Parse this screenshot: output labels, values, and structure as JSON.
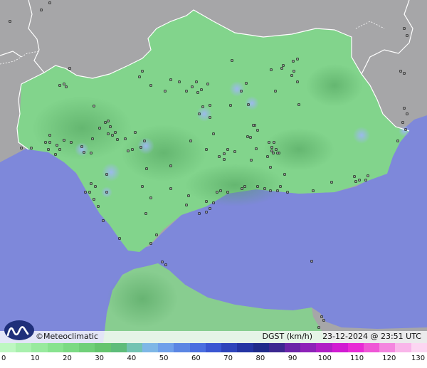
{
  "map": {
    "brand": "©Meteoclimatic",
    "caption_variable": "DGST (km/h)",
    "caption_datetime": "23-12-2024 @ 23:51 UTC",
    "colors": {
      "sea": "#7e88da",
      "foreign_land": "#a6a6a8",
      "region_land": "#82d48c",
      "land_shadow": "#60b56c",
      "borders": "#ffffff",
      "station_marker": "#111111",
      "gust_hotspot": "#8fb0ee"
    }
  },
  "legend": {
    "ticks": [
      "0",
      "10",
      "20",
      "30",
      "40",
      "50",
      "60",
      "70",
      "80",
      "90",
      "100",
      "110",
      "120",
      "130"
    ],
    "colors": [
      "#bdf7c1",
      "#a8f0ad",
      "#98ea9e",
      "#88e38f",
      "#7bda83",
      "#70d079",
      "#65c56e",
      "#5ebc7a",
      "#72c3b2",
      "#7eb7e6",
      "#6fa0ea",
      "#5b86e3",
      "#4a6ee0",
      "#3a56d2",
      "#2e44bb",
      "#2434a3",
      "#1f2a8a",
      "#3b2790",
      "#6a24a8",
      "#8d22b8",
      "#b01ec5",
      "#d11ad2",
      "#e82ad5",
      "#ef56d6",
      "#f486df",
      "#f9b6ea",
      "#fcd6f2"
    ]
  }
}
